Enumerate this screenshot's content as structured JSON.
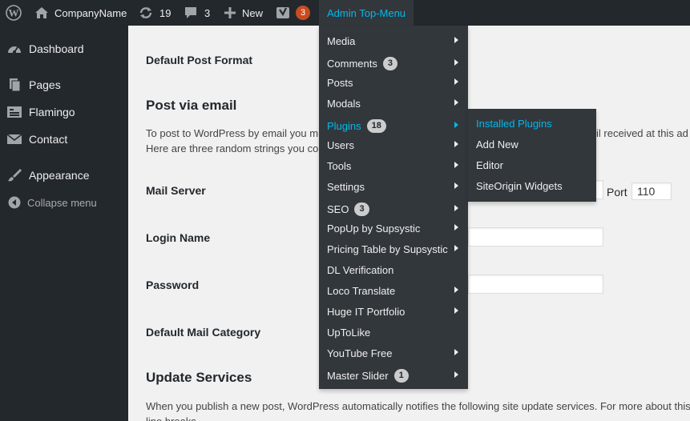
{
  "admin_bar": {
    "site_name": "CompanyName",
    "updates_count": "19",
    "comments_count": "3",
    "new_label": "New",
    "yoast_count": "3",
    "top_menu_label": "Admin Top-Menu",
    "icons": {
      "wp": "wordpress-logo-icon",
      "home": "home-icon",
      "updates": "refresh-icon",
      "comments": "comment-icon",
      "new": "plus-icon",
      "yoast": "yoast-icon"
    }
  },
  "sidebar": {
    "items": [
      {
        "label": "Dashboard",
        "icon": "dashboard-icon"
      },
      {
        "label": "Pages",
        "icon": "pages-icon"
      },
      {
        "label": "Flamingo",
        "icon": "flamingo-icon"
      },
      {
        "label": "Contact",
        "icon": "mail-icon"
      },
      {
        "label": "Appearance",
        "icon": "brush-icon"
      }
    ],
    "collapse_label": "Collapse menu"
  },
  "content": {
    "default_post_format_label": "Default Post Format",
    "post_via_email_heading": "Post via email",
    "post_via_email_desc_1": "To post to WordPress by email you mu",
    "post_via_email_desc_1_tail": "il received at this ad",
    "post_via_email_desc_2": "Here are three random strings you cou",
    "mail_server_label": "Mail Server",
    "port_label": "Port",
    "port_value": "110",
    "login_name_label": "Login Name",
    "password_label": "Password",
    "default_mail_category_label": "Default Mail Category",
    "update_services_heading": "Update Services",
    "update_services_desc": "When you publish a new post, WordPress automatically notifies the following site update services. For more about this",
    "update_services_desc_2": "line breaks"
  },
  "top_menu": {
    "items": [
      {
        "label": "Media",
        "bubble": "",
        "submenu": true
      },
      {
        "label": "Comments",
        "bubble": "3",
        "submenu": true
      },
      {
        "label": "Posts",
        "bubble": "",
        "submenu": true
      },
      {
        "label": "Modals",
        "bubble": "",
        "submenu": true
      },
      {
        "label": "Plugins",
        "bubble": "18",
        "submenu": true,
        "active": true
      },
      {
        "label": "Users",
        "bubble": "",
        "submenu": true
      },
      {
        "label": "Tools",
        "bubble": "",
        "submenu": true
      },
      {
        "label": "Settings",
        "bubble": "",
        "submenu": true
      },
      {
        "label": "SEO",
        "bubble": "3",
        "submenu": true
      },
      {
        "label": "PopUp by Supsystic",
        "bubble": "",
        "submenu": true
      },
      {
        "label": "Pricing Table by Supsystic",
        "bubble": "",
        "submenu": true
      },
      {
        "label": "DL Verification",
        "bubble": "",
        "submenu": false
      },
      {
        "label": "Loco Translate",
        "bubble": "",
        "submenu": true
      },
      {
        "label": "Huge IT Portfolio",
        "bubble": "",
        "submenu": true
      },
      {
        "label": "UpToLike",
        "bubble": "",
        "submenu": false
      },
      {
        "label": "YouTube Free",
        "bubble": "",
        "submenu": true
      },
      {
        "label": "Master Slider",
        "bubble": "1",
        "submenu": true
      }
    ]
  },
  "plugins_submenu": {
    "items": [
      {
        "label": "Installed Plugins",
        "active": true
      },
      {
        "label": "Add New"
      },
      {
        "label": "Editor"
      },
      {
        "label": "SiteOrigin Widgets"
      }
    ]
  },
  "colors": {
    "bar_bg": "#23282d",
    "menu_bg": "#32373c",
    "accent": "#00b9eb",
    "badge_orange": "#ca4a1f"
  }
}
